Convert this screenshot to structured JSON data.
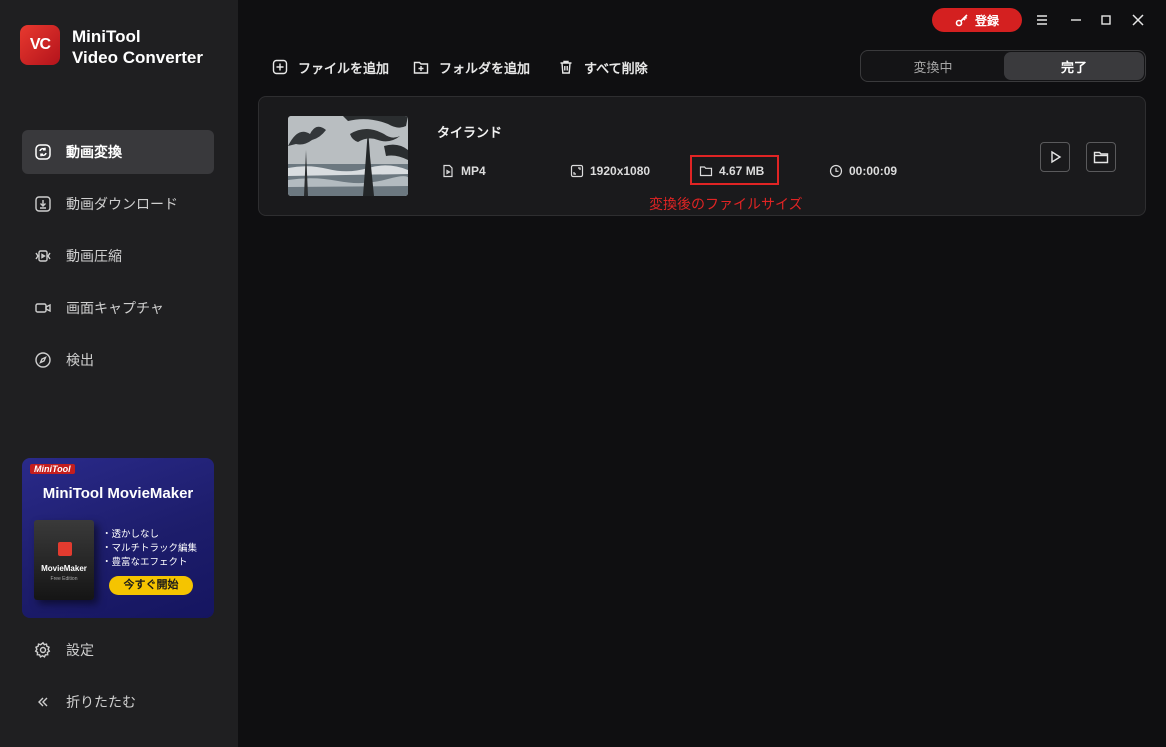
{
  "app": {
    "logo_text": "VC",
    "title_line1": "MiniTool",
    "title_line2": "Video Converter"
  },
  "sidebar": {
    "items": [
      {
        "label": "動画変換",
        "icon": "convert-icon",
        "active": true
      },
      {
        "label": "動画ダウンロード",
        "icon": "download-icon",
        "active": false
      },
      {
        "label": "動画圧縮",
        "icon": "compress-icon",
        "active": false
      },
      {
        "label": "画面キャプチャ",
        "icon": "camera-icon",
        "active": false
      },
      {
        "label": "検出",
        "icon": "compass-icon",
        "active": false
      }
    ],
    "settings_label": "設定",
    "collapse_label": "折りたたむ"
  },
  "promo": {
    "brand": "MiniTool",
    "title": "MiniTool MovieMaker",
    "box_name": "MovieMaker",
    "box_sub": "Free Edition",
    "features": [
      "・透かしなし",
      "・マルチトラック編集",
      "・豊富なエフェクト"
    ],
    "cta": "今すぐ開始"
  },
  "topbar": {
    "register_label": "登録"
  },
  "toolbar": {
    "add_file": "ファイルを追加",
    "add_folder": "フォルダを追加",
    "delete_all": "すべて削除"
  },
  "tabs": {
    "converting": "変換中",
    "done": "完了"
  },
  "file": {
    "name": "タイランド",
    "format": "MP4",
    "resolution": "1920x1080",
    "size": "4.67 MB",
    "duration": "00:00:09"
  },
  "annotation": "変換後のファイルサイズ",
  "colors": {
    "accent_red": "#d42020",
    "annotation_red": "#e02424",
    "promo_cta": "#f5c400"
  }
}
